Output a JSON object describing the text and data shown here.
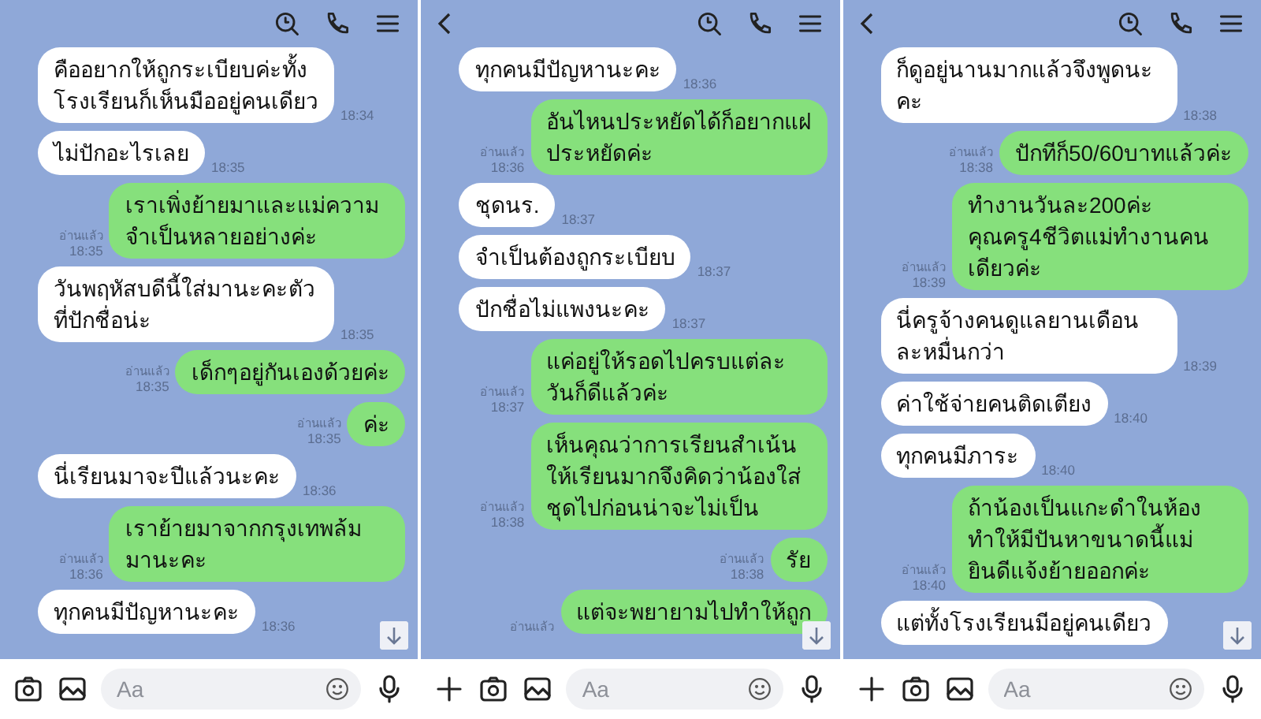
{
  "panels": [
    {
      "messages": [
        {
          "kind": "received",
          "text": "คืออยากให้ถูกระเบียบค่ะทั้งโรงเรียนก็เห็นมืออยู่คนเดียว",
          "time": "18:34"
        },
        {
          "kind": "received",
          "text": "ไม่ปักอะไรเลย",
          "time": "18:35"
        },
        {
          "kind": "sent",
          "text": "เราเพิ่งย้ายมาและแม่ความจำเป็นหลายอย่างค่ะ",
          "status": "อ่านแล้ว",
          "time": "18:35"
        },
        {
          "kind": "received",
          "text": "วันพฤหัสบดีนี้ใส่มานะคะตัวที่ปักชื่อน่ะ",
          "time": "18:35"
        },
        {
          "kind": "sent",
          "text": "เด็กๆอยู่กันเองด้วยค่ะ",
          "status": "อ่านแล้ว",
          "time": "18:35"
        },
        {
          "kind": "sent",
          "text": "ค่ะ",
          "status": "อ่านแล้ว",
          "time": "18:35"
        },
        {
          "kind": "received",
          "text": "นี่เรียนมาจะปีแล้วนะคะ",
          "time": "18:36"
        },
        {
          "kind": "sent",
          "text": "เราย้ายมาจากกรุงเทพล้มมานะคะ",
          "status": "อ่านแล้ว",
          "time": "18:36"
        },
        {
          "kind": "received",
          "text": "ทุกคนมีปัญหานะคะ",
          "time": "18:36"
        }
      ],
      "scroll_down_button": true,
      "composer": {
        "buttons": [
          {
            "kind": "camera"
          },
          {
            "kind": "image"
          }
        ],
        "placeholder": "Aa"
      }
    },
    {
      "back_button": true,
      "messages": [
        {
          "kind": "received",
          "text": "ทุกคนมีปัญหานะคะ",
          "time": "18:36"
        },
        {
          "kind": "sent",
          "text": "อันไหนประหยัดได้ก็อยากแฝประหยัดค่ะ",
          "status": "อ่านแล้ว",
          "time": "18:36"
        },
        {
          "kind": "received",
          "text": "ชุดนร.",
          "time": "18:37"
        },
        {
          "kind": "received",
          "text": "จำเป็นต้องถูกระเบียบ",
          "time": "18:37"
        },
        {
          "kind": "received",
          "text": "ปักชื่อไม่แพงนะคะ",
          "time": "18:37"
        },
        {
          "kind": "sent",
          "text": "แค่อยู่ให้รอดไปครบแต่ละวันก็ดีแล้วค่ะ",
          "status": "อ่านแล้ว",
          "time": "18:37"
        },
        {
          "kind": "sent",
          "text": "เห็นคุณว่าการเรียนสำเน้นให้เรียนมากจึงคิดว่าน้องใส่ชุดไปก่อนน่าจะไม่เป็น",
          "status": "อ่านแล้ว",
          "time": "18:38"
        },
        {
          "kind": "sent",
          "text": "รัย",
          "status": "อ่านแล้ว",
          "time": "18:38"
        },
        {
          "kind": "sent",
          "text": "แต่จะพยายามไปทำให้ถูก",
          "status": "อ่านแล้ว"
        }
      ],
      "scroll_down_button": true,
      "composer": {
        "buttons": [
          {
            "kind": "plus"
          },
          {
            "kind": "camera"
          },
          {
            "kind": "image"
          }
        ],
        "placeholder": "Aa"
      }
    },
    {
      "back_button": true,
      "messages": [
        {
          "kind": "received",
          "text": "ก็ดูอยู่นานมากแล้วจึงพูดนะคะ",
          "time": "18:38"
        },
        {
          "kind": "sent",
          "text": "ปักทีก็50/60บาทแล้วค่ะ",
          "status": "อ่านแล้ว",
          "time": "18:38"
        },
        {
          "kind": "sent",
          "text": "ทำงานวันละ200ค่ะ คุณครู4ชีวิตแม่ทำงานคนเดียวค่ะ",
          "status": "อ่านแล้ว",
          "time": "18:39"
        },
        {
          "kind": "received",
          "text": "นี่ครูจ้างคนดูแลยานเดือนละหมื่นกว่า",
          "time": "18:39"
        },
        {
          "kind": "received",
          "text": "ค่าใช้จ่ายคนติดเตียง",
          "time": "18:40"
        },
        {
          "kind": "received",
          "text": "ทุกคนมีภาระ",
          "time": "18:40"
        },
        {
          "kind": "sent",
          "text": "ถ้าน้องเป็นแกะดำในห้องทำให้มีปันหาขนาดนี้แม่ยินดีแจ้งย้ายออกค่ะ",
          "status": "อ่านแล้ว",
          "time": "18:40"
        },
        {
          "kind": "received",
          "text": "แต่ทั้งโรงเรียนมีอยู่คนเดียว"
        }
      ],
      "scroll_down_button": true,
      "composer": {
        "buttons": [
          {
            "kind": "plus"
          },
          {
            "kind": "camera"
          },
          {
            "kind": "image"
          }
        ],
        "placeholder": "Aa"
      }
    }
  ]
}
